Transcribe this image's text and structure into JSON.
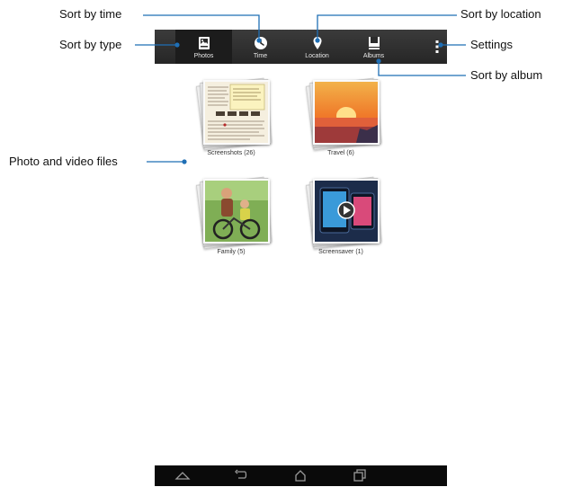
{
  "tabs": [
    {
      "label": "Photos",
      "icon": "photos-icon"
    },
    {
      "label": "Time",
      "icon": "clock-icon"
    },
    {
      "label": "Location",
      "icon": "location-pin-icon"
    },
    {
      "label": "Albums",
      "icon": "album-icon"
    }
  ],
  "albums": [
    {
      "caption": "Screenshots (26)"
    },
    {
      "caption": "Travel (6)"
    },
    {
      "caption": "Family (5)"
    },
    {
      "caption": "Screensaver (1)"
    }
  ],
  "callouts": {
    "sort_by_time": "Sort by time",
    "sort_by_type": "Sort by type",
    "sort_by_location": "Sort by location",
    "settings": "Settings",
    "sort_by_album": "Sort by album",
    "photo_video_files": "Photo and video files"
  },
  "navbar": {
    "icons": [
      "back-icon",
      "home-icon",
      "recent-apps-icon"
    ]
  },
  "colors": {
    "callout_line": "#1f6fb5",
    "action_bar": "#2b2b2b",
    "nav_bar": "#0a0a0a"
  }
}
